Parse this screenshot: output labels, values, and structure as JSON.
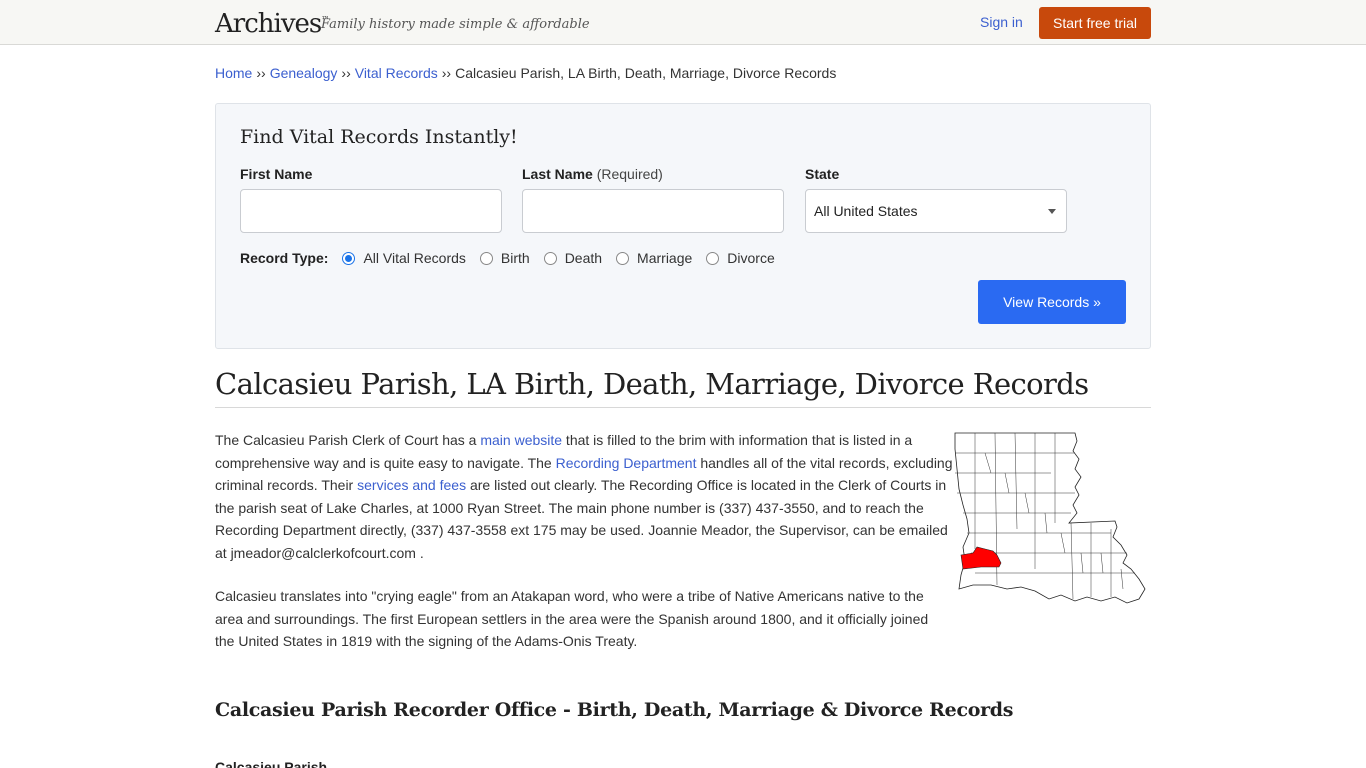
{
  "header": {
    "logo": "Archives",
    "logo_tm": "™",
    "tagline": "Family history made simple & affordable",
    "sign_in": "Sign in",
    "trial_button": "Start free trial"
  },
  "breadcrumb": {
    "items": [
      "Home",
      "Genealogy",
      "Vital Records"
    ],
    "separator": "››",
    "current": "Calcasieu Parish, LA Birth, Death, Marriage, Divorce Records"
  },
  "search": {
    "title": "Find Vital Records Instantly!",
    "first_name_label": "First Name",
    "first_name_value": "",
    "last_name_label": "Last Name",
    "last_name_required": "(Required)",
    "last_name_value": "",
    "state_label": "State",
    "state_selected": "All United States",
    "record_type_label": "Record Type:",
    "record_types": [
      {
        "label": "All Vital Records",
        "checked": true
      },
      {
        "label": "Birth",
        "checked": false
      },
      {
        "label": "Death",
        "checked": false
      },
      {
        "label": "Marriage",
        "checked": false
      },
      {
        "label": "Divorce",
        "checked": false
      }
    ],
    "submit": "View Records »"
  },
  "main": {
    "title": "Calcasieu Parish, LA Birth, Death, Marriage, Divorce Records",
    "para1": {
      "t1": "The Calcasieu Parish Clerk of Court has a ",
      "link1": "main website",
      "t2": " that is filled to the brim with information that is listed in a comprehensive way and is quite easy to navigate. The ",
      "link2": "Recording Department",
      "t3": " handles all of the vital records, excluding criminal records. Their ",
      "link3": "services and fees",
      "t4": " are listed out clearly. The Recording Office is located in the Clerk of Courts in the parish seat of Lake Charles, at 1000 Ryan Street. The main phone number is (337) 437-3550, and to reach the Recording Department directly, (337) 437-3558 ext 175 may be used. Joannie Meador, the Supervisor, can be emailed at jmeador@calclerkofcourt.com ."
    },
    "para2": "Calcasieu translates into \"crying eagle\" from an Atakapan word, who were a tribe of Native Americans native to the area and surroundings. The first European settlers in the area were the Spanish around 1800, and it officially joined the United States in 1819 with the signing of the Adams-Onis Treaty.",
    "map_highlight_color": "#ff0000",
    "subtitle": "Calcasieu Parish Recorder Office - Birth, Death, Marriage & Divorce Records",
    "office_name": "Calcasieu Parish"
  },
  "colors": {
    "link": "#3b5fcf",
    "trial_button": "#c8490c",
    "view_button": "#2a6af2"
  }
}
